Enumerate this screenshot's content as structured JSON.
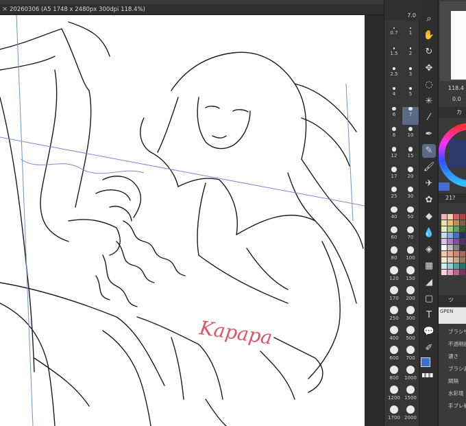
{
  "canvas_tab": {
    "close_label": "×",
    "title": "20260306 (A5 1748 x 2480px 300dpi 118.4%)"
  },
  "signature": "Kapapa",
  "brush_panel": {
    "top_value": "7.0",
    "sizes": [
      "0.7",
      "1",
      "1.5",
      "2",
      "2.5",
      "3",
      "4",
      "5",
      "6",
      "7",
      "8",
      "10",
      "12",
      "15",
      "17",
      "20",
      "25",
      "30",
      "40",
      "50",
      "60",
      "70",
      "80",
      "100",
      "120",
      "150",
      "170",
      "200",
      "250",
      "300",
      "400",
      "500",
      "600",
      "700",
      "800",
      "1000",
      "1200",
      "1500",
      "1700",
      "2000"
    ],
    "selected": "7"
  },
  "tools": [
    {
      "icon": "search-icon",
      "glyph": "⌕"
    },
    {
      "icon": "hand-icon",
      "glyph": "✋"
    },
    {
      "icon": "rotate-icon",
      "glyph": "↻"
    },
    {
      "icon": "move-icon",
      "glyph": "✥"
    },
    {
      "icon": "lasso-icon",
      "glyph": "◌"
    },
    {
      "icon": "magic-wand-icon",
      "glyph": "✳"
    },
    {
      "icon": "eyedropper-icon",
      "glyph": "⁄"
    },
    {
      "icon": "pen-icon",
      "glyph": "✒"
    },
    {
      "icon": "pencil-icon",
      "glyph": "✎"
    },
    {
      "icon": "brush-icon",
      "glyph": "🖌"
    },
    {
      "icon": "airbrush-icon",
      "glyph": "✈"
    },
    {
      "icon": "decoration-icon",
      "glyph": "✿"
    },
    {
      "icon": "eraser-icon",
      "glyph": "◆"
    },
    {
      "icon": "blend-icon",
      "glyph": "💧"
    },
    {
      "icon": "fill-icon",
      "glyph": "◈"
    },
    {
      "icon": "gradient-icon",
      "glyph": "▦"
    },
    {
      "icon": "figure-icon",
      "glyph": "◢"
    },
    {
      "icon": "frame-icon",
      "glyph": "▢"
    },
    {
      "icon": "text-icon",
      "glyph": "T"
    },
    {
      "icon": "balloon-icon",
      "glyph": "💬"
    },
    {
      "icon": "line-correct-icon",
      "glyph": "✐"
    }
  ],
  "right_panel": {
    "zoom_value": "118.4",
    "rotation_value": "0.0",
    "color_header": "カ",
    "palette_header": "21?",
    "subtool_header": "ツ",
    "pen_tag": "GPEN",
    "props": [
      "ブラシサ-",
      "不透明度",
      "濃さ",
      "ブラシ濃",
      "間隔",
      "水彩境",
      "手ブレ補"
    ]
  },
  "colors": {
    "main": "#3f6fd0",
    "sub": "#1a1a1a",
    "signature": "#e05566",
    "guide": "#6f8fd6",
    "selected": "#5a6a86"
  },
  "swatches": [
    "#f2b4b4",
    "#f4d0b0",
    "#d86060",
    "#b04040",
    "#f0e0a0",
    "#e8c070",
    "#c09050",
    "#806040",
    "#e0f0c0",
    "#a0d080",
    "#60a060",
    "#306030",
    "#c0e0f0",
    "#80b0e0",
    "#4070c0",
    "#203060",
    "#e0c0f0",
    "#b080d0",
    "#8050a0",
    "#503070",
    "#ffffff",
    "#c0c0c0",
    "#808080",
    "#303030",
    "#f0c8a8",
    "#e8a888",
    "#d08870",
    "#a86858",
    "#f8e8d8",
    "#e8d0b8",
    "#c8a888",
    "#987858",
    "#d0f0f0",
    "#90d0d0",
    "#50a0a0",
    "#207070",
    "#f8d0e0",
    "#e8a0c0",
    "#c06090",
    "#803060"
  ]
}
